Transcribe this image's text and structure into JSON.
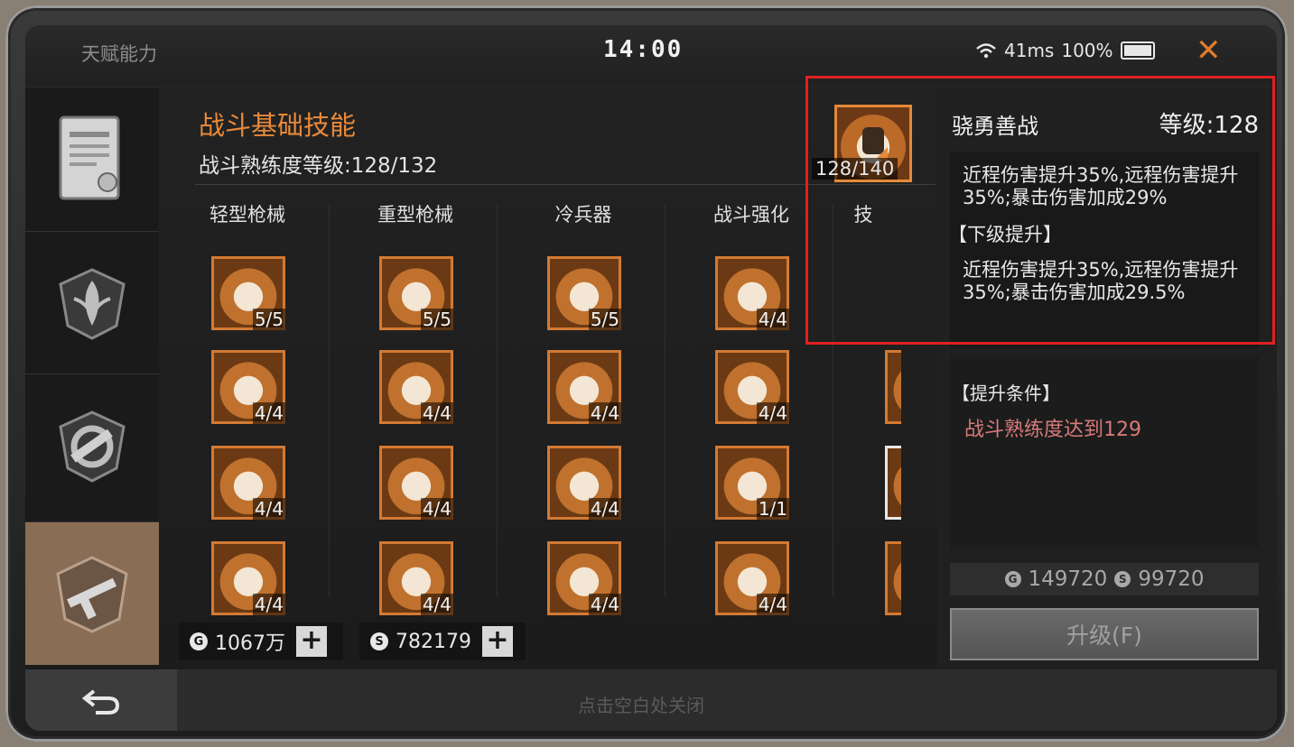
{
  "app": {
    "title": "天赋能力",
    "clock": "14:00",
    "ping": "41ms",
    "battery": "100%"
  },
  "main": {
    "skill_title": "战斗基础技能",
    "skill_level": "战斗熟练度等级:128/132",
    "categories": [
      "轻型枪械",
      "重型枪械",
      "冷兵器",
      "战斗强化",
      "技"
    ],
    "skills": [
      [
        "5/5",
        "5/5",
        "5/5",
        "4/4"
      ],
      [
        "4/4",
        "4/4",
        "4/4",
        "4/4"
      ],
      [
        "4/4",
        "4/4",
        "4/4",
        "1/1"
      ],
      [
        "4/4",
        "4/4",
        "4/4",
        "4/4"
      ]
    ],
    "currency_gold": "1067万",
    "currency_silver": "782179",
    "current_skill_level": "128/140"
  },
  "detail": {
    "name": "骁勇善战",
    "grade": "等级:128",
    "current_effect": "近程伤害提升35%,远程伤害提升35%;暴击伤害加成29%",
    "next_label": "【下级提升】",
    "next_effect": "近程伤害提升35%,远程伤害提升35%;暴击伤害加成29.5%",
    "cond_label": "【提升条件】",
    "condition": "战斗熟练度达到129",
    "cost_gold": "149720",
    "cost_silver": "99720",
    "upgrade_label": "升级(F)"
  },
  "footer": {
    "close_hint": "点击空白处关闭"
  },
  "icons": [
    "certificate-icon",
    "herb-icon",
    "gear-wrench-icon",
    "gun-icon",
    "back-arrow-icon",
    "wifi-icon",
    "battery-icon"
  ],
  "colors": {
    "accent": "#e8893a",
    "highlight": "#e02020",
    "condition": "#d87a7a"
  }
}
